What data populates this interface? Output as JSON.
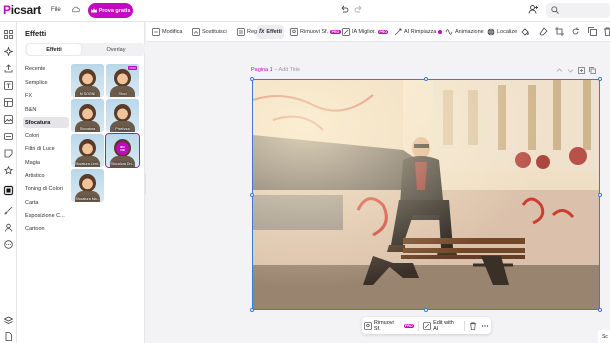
{
  "app": {
    "logo_text_a": "P",
    "logo_text_b": "icsart",
    "file_menu": "File",
    "try_button": "Prova gratis"
  },
  "panel": {
    "title": "Effetti",
    "tabs": [
      "Effetti",
      "Overlay"
    ],
    "categories": [
      "Recente",
      "Semplice",
      "FX",
      "B&N",
      "Sfocatura",
      "Colori",
      "Filtri di Luce",
      "Magia",
      "Artistico",
      "Toning di Colori",
      "Carta",
      "Esposizione C...",
      "Cartoon"
    ],
    "active_category": "Sfocatura",
    "thumbnails": [
      {
        "label": "M SOGNI",
        "pro": false
      },
      {
        "label": "Sfoci",
        "pro": true
      },
      {
        "label": "Sfocatura",
        "pro": false
      },
      {
        "label": "Pixelizza",
        "pro": false
      },
      {
        "label": "Sfocatura Lent...",
        "pro": false
      },
      {
        "label": "Sfocatura Dri...",
        "pro": false,
        "selected": true
      },
      {
        "label": "Sfocatura Ma...",
        "pro": false
      }
    ]
  },
  "toolbar": {
    "items": [
      {
        "label": "Modifica"
      },
      {
        "label": "Sostituisci"
      },
      {
        "label": "Regola"
      },
      {
        "label": "Effetti",
        "active": true
      },
      {
        "label": "Rimuovi Sf.",
        "badge": "PRO"
      },
      {
        "label": "IA Miglior.",
        "badge": "PRO"
      },
      {
        "label": "AI Rimpiazza",
        "dot": true
      },
      {
        "label": "Animazione"
      },
      {
        "label": "Localize"
      }
    ]
  },
  "canvas": {
    "page_label": "Pagina 1",
    "page_title": "Add Title"
  },
  "floatbar": {
    "remove_bg": "Rimuovi Sf.",
    "remove_bg_badge": "PRO",
    "edit_ai": "Edit with AI"
  },
  "help": "Sc",
  "colors": {
    "brand": "#c209c1",
    "selection": "#3d7ad8"
  }
}
